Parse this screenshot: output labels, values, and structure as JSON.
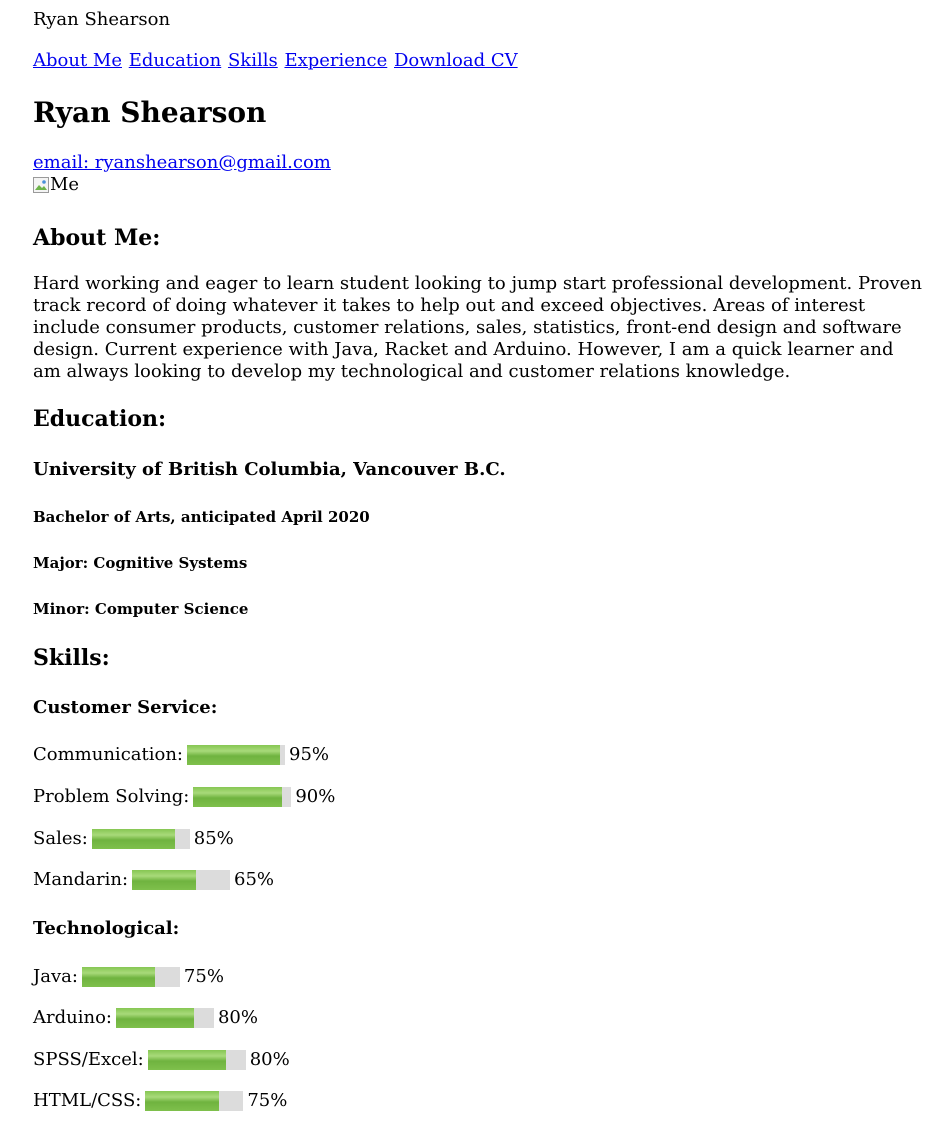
{
  "site_title": "Ryan Shearson",
  "nav": [
    {
      "label": "About Me"
    },
    {
      "label": "Education"
    },
    {
      "label": "Skills"
    },
    {
      "label": "Experience"
    },
    {
      "label": "Download CV"
    }
  ],
  "header": {
    "name": "Ryan Shearson",
    "email": "email: ryanshearson@gmail.com",
    "photo_alt": "Me"
  },
  "about": {
    "heading": "About Me:",
    "text": "Hard working and eager to learn student looking to jump start professional development. Proven track record of doing whatever it takes to help out and exceed objectives. Areas of interest include consumer products, customer relations, sales, statistics, front-end design and software design. Current experience with Java, Racket and Arduino. However, I am a quick learner and am always looking to develop my technological and customer relations knowledge."
  },
  "education": {
    "heading": "Education:",
    "school": "University of British Columbia, Vancouver B.C.",
    "degree": "Bachelor of Arts, anticipated April 2020",
    "major": "Major: Cognitive Systems",
    "minor": "Minor: Computer Science"
  },
  "skills": {
    "heading": "Skills:",
    "customer_service": {
      "heading": "Customer Service:",
      "items": [
        {
          "label": "Communication:",
          "percent_label": "95%",
          "level": 0.95
        },
        {
          "label": "Problem Solving:",
          "percent_label": "90%",
          "level": 0.9
        },
        {
          "label": "Sales:",
          "percent_label": "85%",
          "level": 0.85
        },
        {
          "label": "Mandarin:",
          "percent_label": "65%",
          "level": 0.65
        }
      ]
    },
    "technological": {
      "heading": "Technological:",
      "items": [
        {
          "label": "Java:",
          "percent_label": "75%",
          "level": 0.75
        },
        {
          "label": "Arduino:",
          "percent_label": "80%",
          "level": 0.8
        },
        {
          "label": "SPSS/Excel:",
          "percent_label": "80%",
          "level": 0.8
        },
        {
          "label": "HTML/CSS:",
          "percent_label": "75%",
          "level": 0.75
        }
      ]
    }
  },
  "colors": {
    "link": "#0000ee",
    "bar_track": "#dcdcdc",
    "bar_fill": "#7fc04c"
  }
}
